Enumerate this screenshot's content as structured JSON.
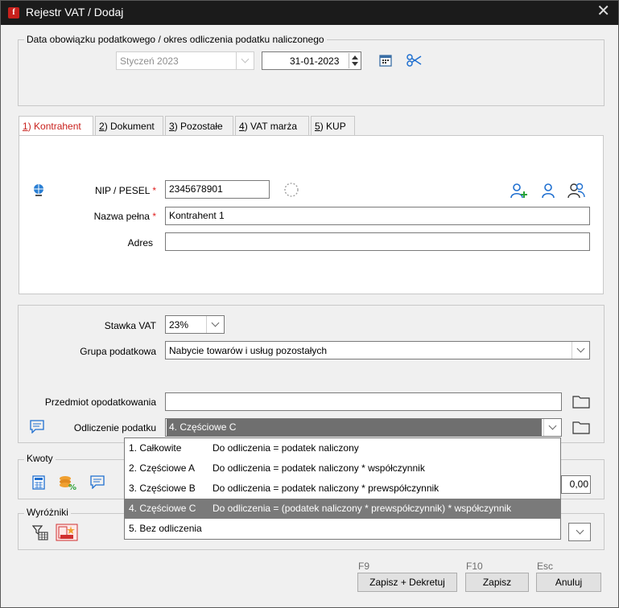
{
  "window": {
    "title": "Rejestr VAT / Dodaj",
    "app_icon": "f",
    "close_glyph": "✕"
  },
  "obligation": {
    "legend": "Data obowiązku podatkowego / okres odliczenia podatku naliczonego",
    "month_value": "Styczeń 2023",
    "date_value": "31-01-2023"
  },
  "tabs": [
    {
      "key": "1",
      "label": ") Kontrahent"
    },
    {
      "key": "2",
      "label": ") Dokument"
    },
    {
      "key": "3",
      "label": ") Pozostałe"
    },
    {
      "key": "4",
      "label": ") VAT marża"
    },
    {
      "key": "5",
      "label": ") KUP"
    }
  ],
  "contractor": {
    "nip_label": "NIP / PESEL",
    "nip_value": "2345678901",
    "name_label": "Nazwa pełna",
    "name_value": "Kontrahent 1",
    "address_label": "Adres",
    "address_value": "",
    "required_mark": "*"
  },
  "vat": {
    "rate_label": "Stawka VAT",
    "rate_value": "23%",
    "group_label": "Grupa podatkowa",
    "group_value": "Nabycie towarów i usług pozostałych",
    "subject_label": "Przedmiot opodatkowania",
    "subject_value": "",
    "deduction_label": "Odliczenie podatku",
    "deduction_value": "4. Częściowe C"
  },
  "deduction_options": [
    {
      "name": "1. Całkowite",
      "desc": "Do odliczenia = podatek naliczony"
    },
    {
      "name": "2. Częściowe A",
      "desc": "Do odliczenia = podatek naliczony * współczynnik"
    },
    {
      "name": "3. Częściowe B",
      "desc": "Do odliczenia = podatek naliczony * prewspółczynnik"
    },
    {
      "name": "4. Częściowe C",
      "desc": "Do odliczenia = (podatek naliczony * prewspółczynnik) * współczynnik"
    },
    {
      "name": "5. Bez odliczenia",
      "desc": ""
    }
  ],
  "selected_option_index": 3,
  "amounts": {
    "legend": "Kwoty",
    "value": "0,00"
  },
  "highlights": {
    "legend": "Wyróżniki"
  },
  "footer": {
    "f9": "F9",
    "f10": "F10",
    "esc": "Esc",
    "save_post": "Zapisz + Dekretuj",
    "save": "Zapisz",
    "cancel": "Anuluj"
  },
  "colors": {
    "accent_red": "#c8201c",
    "icon_blue": "#1f6fd0",
    "selection_gray": "#7a7a7a"
  }
}
